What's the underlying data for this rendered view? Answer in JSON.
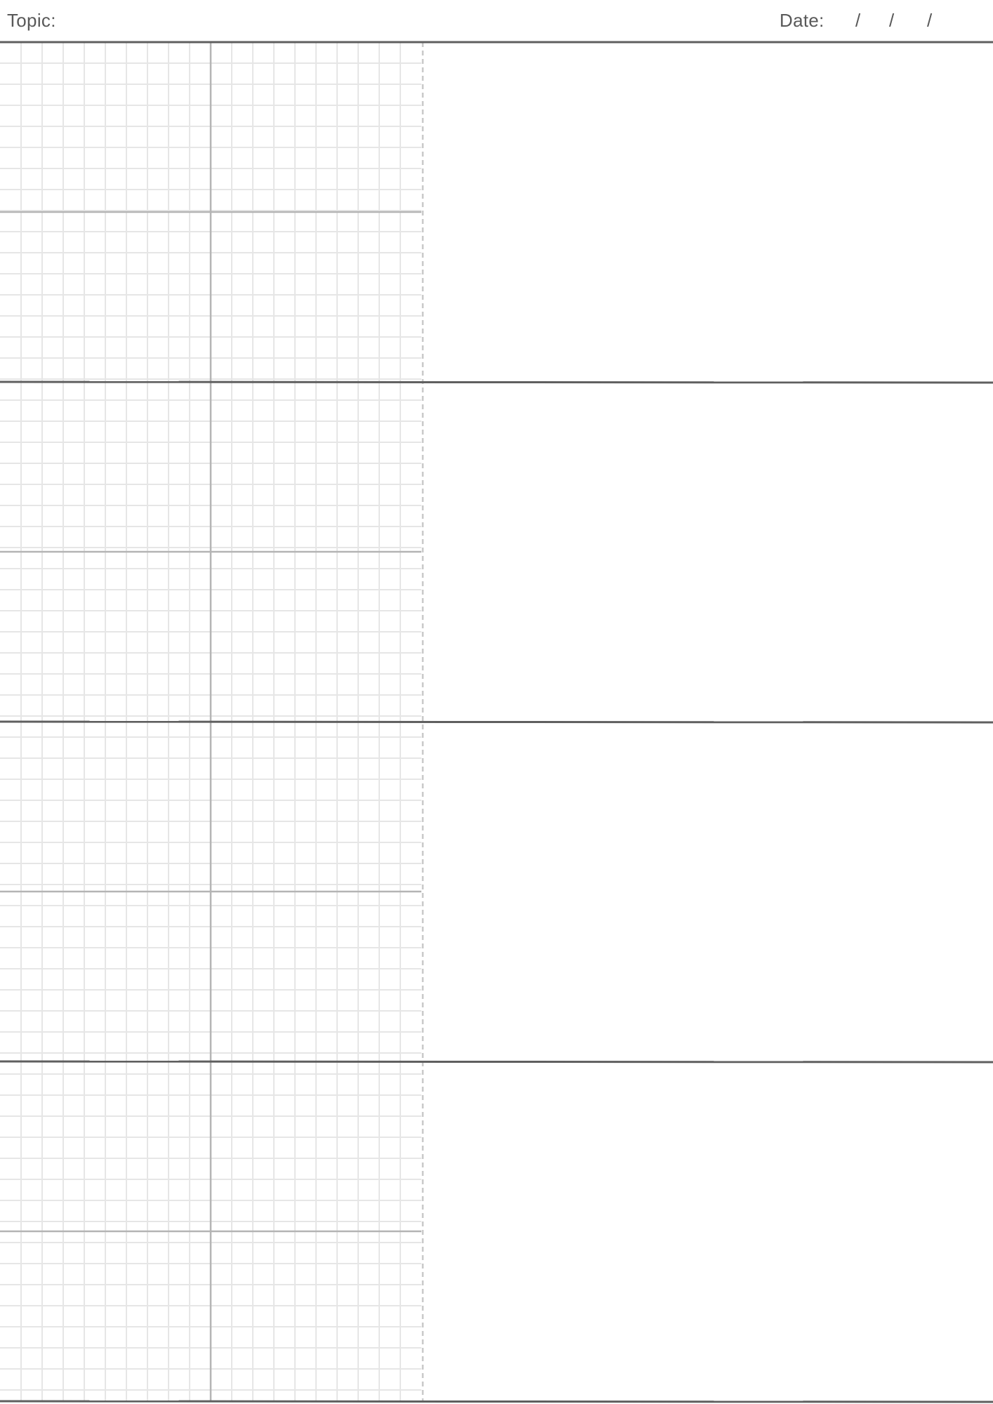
{
  "header": {
    "topic_label": "Topic:",
    "date_label": "Date:",
    "date_separators": [
      "/",
      "/",
      "/"
    ]
  },
  "sheet": {
    "sections": 4,
    "quadrants_per_section": 4
  },
  "colors": {
    "text": "#595959",
    "section_rule": "#5f5f5f",
    "quadrant_rule": "#b4b4b4",
    "grid_line": "#e6e6e6",
    "dashed_divider": "#c8c8c8"
  }
}
